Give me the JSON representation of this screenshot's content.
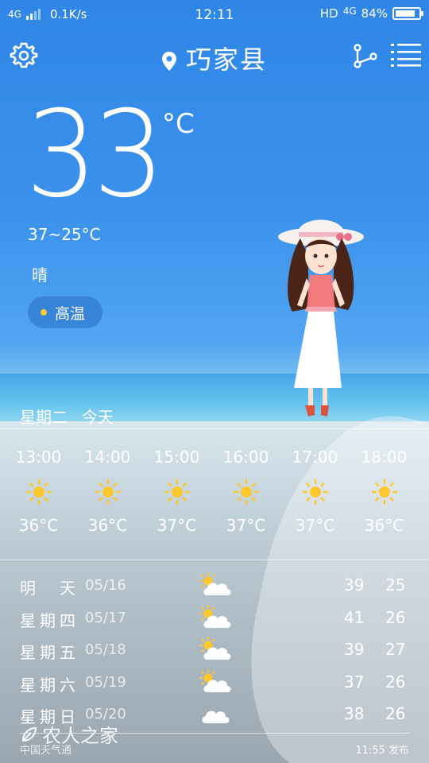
{
  "status": {
    "network_left": "4G",
    "speed": "0.1K/s",
    "time": "12:11",
    "hd": "HD",
    "network_right": "4G",
    "battery": "84%",
    "battery_level": 0.84
  },
  "header": {
    "city": "巧家县"
  },
  "current": {
    "temp": "33",
    "unit": "°C",
    "range": "37~25°C",
    "condition": "晴",
    "badge": "高温"
  },
  "today": {
    "weekday": "星期二",
    "label": "今天"
  },
  "hourly": [
    {
      "time": "13:00",
      "icon": "sun-icon",
      "temp": "36°C"
    },
    {
      "time": "14:00",
      "icon": "sun-icon",
      "temp": "36°C"
    },
    {
      "time": "15:00",
      "icon": "sun-icon",
      "temp": "37°C"
    },
    {
      "time": "16:00",
      "icon": "sun-icon",
      "temp": "37°C"
    },
    {
      "time": "17:00",
      "icon": "sun-icon",
      "temp": "37°C"
    },
    {
      "time": "18:00",
      "icon": "sun-icon",
      "temp": "36°C"
    }
  ],
  "daily": [
    {
      "name": "明天",
      "date": "05/16",
      "icon": "partly-cloudy-icon",
      "high": "39",
      "low": "25"
    },
    {
      "name": "星期四",
      "date": "05/17",
      "icon": "partly-cloudy-icon",
      "high": "41",
      "low": "26"
    },
    {
      "name": "星期五",
      "date": "05/18",
      "icon": "partly-cloudy-icon",
      "high": "39",
      "low": "27"
    },
    {
      "name": "星期六",
      "date": "05/19",
      "icon": "partly-cloudy-icon",
      "high": "37",
      "low": "26"
    },
    {
      "name": "星期日",
      "date": "05/20",
      "icon": "cloud-icon",
      "high": "38",
      "low": "26"
    }
  ],
  "footer": {
    "source": "中国天气通",
    "published": "11:55 发布",
    "watermark": "农人之家"
  },
  "colors": {
    "sun": "#ffc72e",
    "badge_dot": "#ffc83a"
  }
}
